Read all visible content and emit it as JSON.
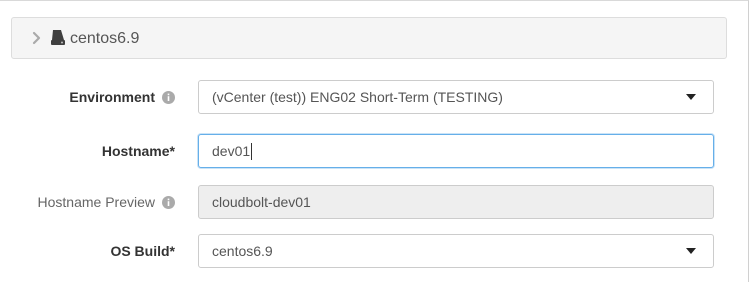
{
  "header": {
    "title": "centos6.9",
    "icons": {
      "expand": "chevron-right-icon",
      "server": "server-icon"
    }
  },
  "form": {
    "environment": {
      "label": "Environment",
      "value": "(vCenter (test)) ENG02 Short-Term (TESTING)",
      "info_icon": "info-circle-icon"
    },
    "hostname": {
      "label": "Hostname*",
      "value": "dev01"
    },
    "hostname_preview": {
      "label": "Hostname Preview",
      "value": "cloudbolt-dev01",
      "info_icon": "info-circle-icon"
    },
    "os_build": {
      "label": "OS Build*",
      "value": "centos6.9"
    }
  },
  "colors": {
    "focus_border": "#66afe9",
    "readonly_bg": "#eeeeee",
    "header_bg": "#f5f5f5"
  }
}
